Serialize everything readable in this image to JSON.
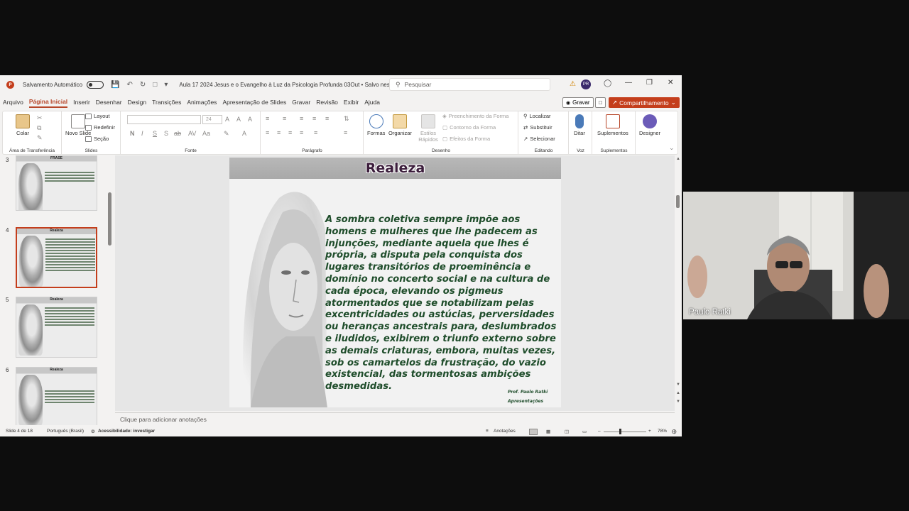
{
  "titlebar": {
    "autosave_label": "Salvamento Automático",
    "doc_title": "Aula 17 2024 Jesus e o Evangelho à Luz da Psicologia Profunda 03Out • Salvo neste PC",
    "search_placeholder": "Pesquisar",
    "avatar_initials": "PR"
  },
  "tabs": [
    "Arquivo",
    "Página Inicial",
    "Inserir",
    "Desenhar",
    "Design",
    "Transições",
    "Animações",
    "Apresentação de Slides",
    "Gravar",
    "Revisão",
    "Exibir",
    "Ajuda"
  ],
  "tab_actions": {
    "record": "Gravar",
    "share": "Compartilhamento"
  },
  "ribbon": {
    "clipboard": {
      "paste": "Colar",
      "label": "Área de Transferência"
    },
    "slides": {
      "new_slide": "Novo Slide",
      "layout": "Layout",
      "reset": "Redefinir",
      "section": "Seção",
      "label": "Slides"
    },
    "font": {
      "size": "24",
      "label": "Fonte"
    },
    "paragraph": {
      "label": "Parágrafo"
    },
    "drawing": {
      "shapes": "Formas",
      "arrange": "Organizar",
      "quick_styles": "Estilos Rápidos",
      "fill": "Preenchimento da Forma",
      "outline": "Contorno da Forma",
      "effects": "Efeitos da Forma",
      "label": "Desenho"
    },
    "editing": {
      "find": "Localizar",
      "replace": "Substituir",
      "select": "Selecionar",
      "label": "Editando"
    },
    "voice": {
      "dictate": "Ditar",
      "label": "Voz"
    },
    "addins": {
      "addins": "Suplementos",
      "label": "Suplementos"
    },
    "designer": {
      "designer": "Designer"
    }
  },
  "thumbnails": [
    {
      "num": "3",
      "title": "FRASE"
    },
    {
      "num": "4",
      "title": "Realeza"
    },
    {
      "num": "5",
      "title": "Realeza"
    },
    {
      "num": "6",
      "title": "Realeza"
    }
  ],
  "slide": {
    "title": "Realeza",
    "body": "A sombra coletiva sempre impõe aos homens e mulheres que lhe padecem as injunções, mediante aquela que lhes é própria, a disputa pela conquista dos lugares transitórios de proeminência e domínio no concerto social e na cultura de cada época, elevando os pigmeus atormentados que se notabilizam pelas excentricidades ou astúcias, perversidades ou heranças ancestrais para, deslumbrados e iludidos, exibirem o triunfo externo sobre as demais criaturas, embora, muitas vezes, sob os camartelos da frustração, do vazio existencial, das tormentosas ambições desmedidas.",
    "credit_line1": "Prof. Paulo Ratki",
    "credit_line2": "Apresentações"
  },
  "notes_placeholder": "Clique para adicionar anotações",
  "status": {
    "slide_of": "Slide 4 de 18",
    "language": "Português (Brasil)",
    "accessibility": "Acessibilidade: investigar",
    "notes": "Anotações",
    "zoom": "78%"
  },
  "video": {
    "participant": "Paulo Ratki"
  },
  "colors": {
    "accent": "#b7472a",
    "share": "#c43e1c",
    "slide_text": "#1f4d2b"
  }
}
